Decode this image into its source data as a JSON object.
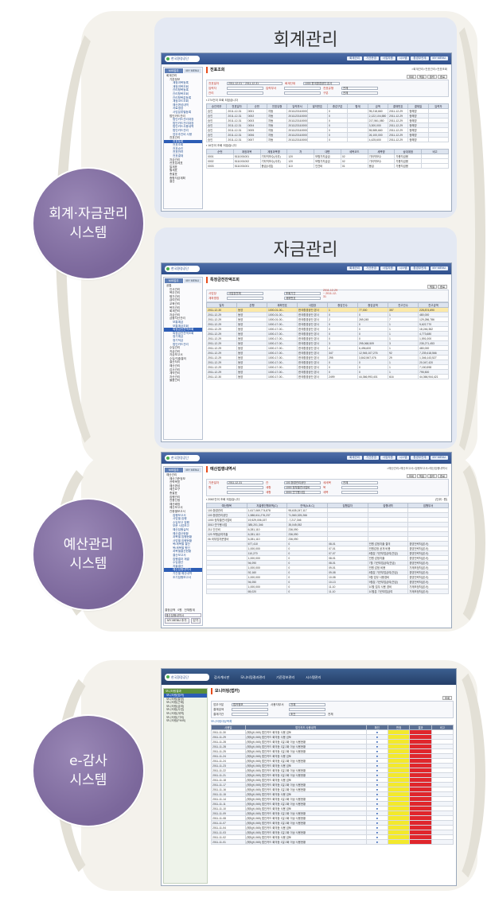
{
  "sections": [
    {
      "id": "accounting",
      "circle_lines": [
        "회계·자금관리",
        "시스템"
      ],
      "cards": [
        {
          "title": "회계관리",
          "screen": {
            "logo": "한국환경공단",
            "menu": [
              "회계관리",
              "기관운영",
              "사업지원",
              "시스템",
              "환경부연계",
              "MY MENU"
            ],
            "side_tabs": [
              "MIS업무",
              "MY MENU"
            ],
            "tree": [
              "회계관리",
              "기본정보",
              "계정과목등록",
              "계정과목조회",
              "관리항목등록",
              "관리항목조회",
              "관리항목값등록",
              "계정코드조회",
              "예산편성내역",
              "자료생성",
              "사업분류별등록",
              "법인카드관리",
              "법인카드관리대장",
              "법인카드관리대장",
              "법인카드사용내역",
              "법인카드관리",
              "업무추진비 사용",
              "전표관리",
              "전표등록",
              "전표조회",
              "전표승인",
              "전표반려",
              "전표결재",
              "자금관리",
              "전표집계표",
              "일계표",
              "월계표",
              "총괄표",
              "종합자금계획",
              "결산"
            ],
            "title": "전표조회",
            "crumb": ">회계관리>전표관리>전표조회",
            "buttons": [
              "조회",
              "엑셀",
              "출력",
              "종료"
            ],
            "form": [
              [
                "전표일자",
                "2011-12-01 ~ 2011-12-31",
                "회계단위",
                "1000 한국환경공단 본사"
              ],
              [
                "입력자",
                "",
                "입력부서",
                "",
                "전표유형",
                "전체"
              ],
              [
                "관리",
                "",
                "",
                "",
                "구분",
                "전체"
              ]
            ],
            "count": "▪ 274건이 조회 되었습니다",
            "headers": [
              "승인여부",
              "전표일자",
              "순번",
              "전표유형",
              "입력부서",
              "발의번호",
              "증감구분",
              "합계",
              "금액",
              "결재번호",
              "결재일",
              "입력자"
            ],
            "rows": [
              [
                "승인",
                "2011-12-31",
                "0001",
                "자동",
                "2011123110000006",
                "",
                "0",
                "",
                "95,218,660",
                "2011-12-29",
                "정혜영"
              ],
              [
                "승인",
                "2011-12-31",
                "0002",
                "자동",
                "2011123110000007",
                "",
                "0",
                "",
                "2,122,104,580",
                "2011-12-29",
                "정혜영"
              ],
              [
                "승인",
                "2011-12-31",
                "0003",
                "자동",
                "2011123110000008",
                "",
                "0",
                "",
                "217,561,080",
                "2011-12-29",
                "정혜영"
              ],
              [
                "승인",
                "2011-12-31",
                "0004",
                "자동",
                "2011123110000009",
                "",
                "0",
                "",
                "3,300,000",
                "2011-12-29",
                "정혜영"
              ],
              [
                "승인",
                "2011-12-31",
                "0005",
                "자동",
                "2011123110000010",
                "",
                "0",
                "",
                "55,585,660",
                "2011-12-29",
                "정혜영"
              ],
              [
                "승인",
                "2011-12-31",
                "0006",
                "자동",
                "2011123110000011",
                "",
                "0",
                "",
                "26,100,000",
                "2011-12-29",
                "정혜영"
              ],
              [
                "승인",
                "2011-12-31",
                "0007",
                "자동",
                "2011123110000012",
                "",
                "0",
                "",
                "4,425,600",
                "2011-12-29",
                "정혜영"
              ]
            ],
            "count2": "▪ 16건이 조회 되었습니다",
            "headers2": [
              "순번",
              "계정과목",
              "계정과목명",
              "차",
              "대변",
              "세목코드",
              "세목명",
              "상대계정",
              "비고"
            ],
            "rows2": [
              [
                "0001",
                "5111001001",
                "기타직보수(사무)",
                "120",
                "보험가지급금",
                "02",
                "기타직보수",
                "가용자금용"
              ],
              [
                "0002",
                "5111001002",
                "기타직보수(사무)",
                "120",
                "보험가지급금",
                "02",
                "기타직보수",
                "가용자금용"
              ],
              [
                "0003",
                "5111001001",
                "봉급(사업)",
                "110",
                "인건비",
                "01",
                "봉급",
                "가용자금용"
              ]
            ]
          }
        },
        {
          "title": "자금관리",
          "screen": {
            "logo": "한국환경공단",
            "menu": [
              "회계관리",
              "기관운영",
              "사업지원",
              "시스템",
              "환경부연계",
              "MY MENU"
            ],
            "side_tabs": [
              "MIS업무",
              "MY MENU"
            ],
            "tree": [
              "공통",
              "인사관리",
              "복무관리",
              "평가관리",
              "급여관리",
              "교육관리",
              "복지관리",
              "회계관리",
              "자금관리",
              "금융자산관리",
              "보통예금",
              "보통예금조회",
              "특정금전잔액조회",
              "특정금전잔액조회",
              "정기예금",
              "정기적금",
              "법인카드관리",
              "수입관리",
              "지급관리",
              "자금보고서",
              "수입/지출결의",
              "결산처리",
              "예산관리",
              "감사관리",
              "계약관리",
              "자산관리",
              "물품관리"
            ],
            "title": "특정금전잔액조회",
            "crumb": "",
            "buttons": [
              "엑셀",
              "종료"
            ],
            "form": [
              [
                "사업장",
                "사업장전체",
                "",
                "조회기간",
                "2011-12-29 ~ 2011-12-31"
              ],
              [
                "계좌명칭",
                "",
                "",
                "계좌번호",
                ""
              ]
            ],
            "headers": [
              "일자",
              "은행",
              "계좌번호",
              "사업장",
              "증감건수",
              "증감금액",
              "잔고건수",
              "잔고금액"
            ],
            "rows": [
              [
                "2011-12-30",
                "동양",
                "1000-01-00...",
                "한국환경공단 본사",
                "1",
                "77,000",
                "357",
                "228,874,690"
              ],
              [
                "2011-12-29",
                "동양",
                "1000-01-00...",
                "한국환경공단 본사",
                "0",
                "0",
                "1",
                "480,000"
              ],
              [
                "2011-12-29",
                "동양",
                "1000-01-00...",
                "한국환경공단 본사",
                "2",
                "269,245",
                "7",
                "129,286,786"
              ],
              [
                "2011-12-29",
                "동양",
                "1000-17-00...",
                "한국환경공단 본사",
                "0",
                "0",
                "1",
                "5,622,770"
              ],
              [
                "2011-12-29",
                "동양",
                "1000-17-00...",
                "한국환경공단 본사",
                "0",
                "0",
                "1",
                "18,246,382"
              ],
              [
                "2011-12-29",
                "동양",
                "1000-17-00...",
                "한국환경공단 본사",
                "0",
                "0",
                "1",
                "4,773,680"
              ],
              [
                "2011-12-29",
                "동양",
                "1000-17-00...",
                "한국환경공단 본사",
                "0",
                "0",
                "1",
                "1,591,000"
              ],
              [
                "2011-12-29",
                "동양",
                "1000-17-00...",
                "한국환경공단 본사",
                "3",
                "295,068,509",
                "3",
                "235,271,453"
              ],
              [
                "2011-12-29",
                "동양",
                "1000-17-00...",
                "한국환경공단 본사",
                "4",
                "6,496,600",
                "1",
                "480,000"
              ],
              [
                "2011-12-29",
                "동양",
                "1000-17-00...",
                "한국환경공단 본사",
                "347",
                "12,945,107,276",
                "92",
                "7,239,418,566"
              ],
              [
                "2011-12-29",
                "동양",
                "1000-17-00...",
                "한국환경공단 본사",
                "295",
                "3,842,567,076",
                "29",
                "1,346,143,527"
              ],
              [
                "2011-12-29",
                "동양",
                "1000-17-00...",
                "한국환경공단 본사",
                "0",
                "0",
                "1",
                "20,047,420"
              ],
              [
                "2011-12-29",
                "동양",
                "1000-17-00...",
                "한국환경공단 본사",
                "0",
                "0",
                "1",
                "7,150,598"
              ],
              [
                "2011-12-29",
                "동양",
                "1000-17-00...",
                "한국환경공단 본사",
                "0",
                "0",
                "1",
                "795,500"
              ],
              [
                "2011-12-30",
                "동양",
                "1000-17-00...",
                "한국환경공단 본사",
                "2499",
                "44,366,993,401",
                "616",
                "44,366,944,421"
              ]
            ]
          }
        }
      ]
    },
    {
      "id": "budget",
      "circle_lines": [
        "예산관리",
        "시스템"
      ],
      "screen": {
        "logo": "한국환경공단",
        "menu": [
          "회계관리",
          "기관운영",
          "사업지원",
          "시스템",
          "환경부연계",
          "MY MENU"
        ],
        "side_tabs": [
          "MIS업무",
          "MY MENU"
        ],
        "tree": [
          "예산관리",
          "예산기준정보",
          "전략목표",
          "예산편성",
          "예산요구",
          "총괄표",
          "집행관리",
          "전용신청",
          "예산배정",
          "예산보고서",
          "관종별보고서",
          "집행보고서",
          "사업별 집행",
          "수입보고 집행",
          "부문 사업보고",
          "예산집행실적",
          "예산결산현황",
          "과목별 집행현황",
          "사업별 집행현황",
          "목/세목별 결산",
          "목/세목별 원인",
          "과목별결산현황",
          "결산보고서",
          "집행결과 재결",
          "수입결산",
          "지출결산",
          "예산집행내역서",
          "기간별 예산내역",
          "조기집행보고서"
        ],
        "side_bottom": [
          "결정금액",
          "0원",
          "전체합계"
        ],
        "side_select": "예산집행내역서",
        "side_btns": [
          "MY MENU 추가",
          "닫기"
        ],
        "title": "예산집행내역서",
        "crumb": ">예산관리>예산보고서>집행보고서>예산집행내역서",
        "buttons": [
          "조회",
          "엑셀",
          "출력",
          "종료"
        ],
        "form": [
          [
            "기준일자",
            "2011-12-31",
            "관",
            "100 환경관리공단",
            "세세목",
            "전체"
          ],
          [
            "항",
            "",
            "세항",
            "1000 정부출연사업비",
            "목",
            ""
          ],
          [
            "",
            "",
            "세항",
            "3000 연구용사업",
            "세목",
            ""
          ]
        ],
        "count": "▪ 2082건이 조회 되었습니다",
        "unit": "(단위 : 원)",
        "headers": [
          "예산항목",
          "지출원인행위액(C)",
          "잔액(A-B-C)",
          "집행일자",
          "집행내역",
          "집행부서"
        ],
        "rows": [
          [
            "100 환경관리",
            "1,617,069,774,878",
            "95,635,247,117",
            "",
            "",
            ""
          ],
          [
            "100 환경관리공단",
            "1,588,611,276,237",
            "71,560,325,266",
            "",
            "",
            ""
          ],
          [
            "1000 정부출연사업비",
            "19,529,006,157",
            "-7,217,346",
            "",
            "",
            ""
          ],
          [
            "3010 연구용사업",
            "385,201,346",
            "35,045,052",
            "",
            "",
            ""
          ],
          [
            "211 인건비",
            "6,281,110",
            "236,090",
            "",
            "",
            ""
          ],
          [
            "120 보험급여지출",
            "6,281,110",
            "236,090",
            "",
            "",
            ""
          ],
          [
            "06 외부업자운영비",
            "6,281,110",
            "236,090",
            "",
            "",
            ""
          ],
          [
            "",
            "677,410",
            "0",
            "08-01",
            "민원 감정지출 결의",
            "경영전략처(본사)"
          ],
          [
            "",
            "1,000,000",
            "0",
            "07-01",
            "민원감정 공개 비용",
            "경영전략처(본사)"
          ],
          [
            "",
            "110,270",
            "0",
            "07-07",
            "8월분 기관부업급여(연금)",
            "경영전략처(본사)"
          ],
          [
            "",
            "1,000,000",
            "0",
            "08-01",
            "민원 감정지출",
            "경영전략처(본사)"
          ],
          [
            "",
            "94,090",
            "0",
            "08-01",
            "7월 기관부업급여(연금)",
            "경영전략처(본사)"
          ],
          [
            "",
            "1,000,000",
            "0",
            "09-01",
            "민원 감정 비용",
            "가재조정처(본사)"
          ],
          [
            "",
            "92,160",
            "0",
            "09-08",
            "8월분 기관부업급여(연금)",
            "경영전략처(본사)"
          ],
          [
            "",
            "1,000,000",
            "0",
            "10-08",
            "9월 업무 사용경비",
            "경영전략처(본사)"
          ],
          [
            "",
            "94,050",
            "0",
            "10-13",
            "9월분 기관부업급여(연금)",
            "경영전략처(본사)"
          ],
          [
            "",
            "1,000,000",
            "0",
            "11-10",
            "10월 업무 사용 경비",
            "가재조정처(본사)"
          ],
          [
            "",
            "65,020",
            "0",
            "11-10",
            "10월분 기관부업급여",
            "가재조정처(본사)"
          ]
        ]
      }
    },
    {
      "id": "audit",
      "circle_lines": [
        "e-감사",
        "시스템"
      ],
      "screen": {
        "logo": "한국환경공단",
        "nav": [
          "감사계시판",
          "모니터링결과관리",
          "기준정보관리",
          "시스템관리"
        ],
        "side_header": "모니터링결과",
        "tree": [
          "모니터링(법카)",
          "모니터링(출장)",
          "모니터링(근태)",
          "모니터링(급여)",
          "모니터링(사업)",
          "모니터링(계약)",
          "모니터링(기타)",
          "모니터링(FMIS)"
        ],
        "title": "모니터링(법카)",
        "buttons": [
          "조회"
        ],
        "form": [
          [
            "업무구분",
            "법카정보",
            "사용자부서",
            "전체"
          ],
          [
            "결재검색",
            "",
            "",
            ""
          ],
          [
            "결재기간",
            "",
            "",
            " 조건",
            "전체"
          ]
        ],
        "list_title": "모니터링대상목록",
        "headers": [
          "사용일",
          "법인카드 사용내역",
          "확인",
          "판정",
          "결과",
          "비고"
        ],
        "rows": [
          [
            "2011-11-30",
            "(제5)(K,065) 법인카드 회의등 사용 검토"
          ],
          [
            "2011-11-29",
            "(제5)(K,065) 법인카드 회의등 사용 검토"
          ],
          [
            "2011-11-28",
            "(제5)(K,065) 법인카드 회의등 1일 2회 이상 사용현황"
          ],
          [
            "2011-11-28",
            "(제5)(K,065) 법인카드 회의등 1일 2회 이상 사용현황"
          ],
          [
            "2011-11-25",
            "(제5)(K,065) 법인카드 회의등 1일 2회 이상 사용현황"
          ],
          [
            "2011-11-24",
            "(제5)(K,065) 법인카드 회의등 사용 검토"
          ],
          [
            "2011-11-24",
            "(제5)(K,065) 법인카드 회의등 1일 2회 이상 사용현황"
          ],
          [
            "2011-11-23",
            "(제5)(K,065) 법인카드 회의등 사용 검토"
          ],
          [
            "2011-11-22",
            "(제5)(K,065) 법인카드 회의등 1일 2회 이상 사용현황"
          ],
          [
            "2011-11-21",
            "(제5)(K,065) 법인카드 회의등 1일 2회 이상 사용현황"
          ],
          [
            "2011-11-18",
            "(제5)(K,065) 법인카드 회의등 사용 검토"
          ],
          [
            "2011-11-17",
            "(제5)(K,065) 법인카드 회의등 1일 2회 이상 사용현황"
          ],
          [
            "2011-11-16",
            "(제5)(K,065) 법인카드 회의등 1일 2회 이상 사용현황"
          ],
          [
            "2011-11-15",
            "(제5)(K,065) 법인카드 회의등 사용 검토"
          ],
          [
            "2011-11-14",
            "(제5)(K,065) 법인카드 회의등 1일 2회 이상 사용현황"
          ],
          [
            "2011-11-11",
            "(제5)(K,065) 법인카드 회의등 1일 2회 이상 사용현황"
          ],
          [
            "2011-11-10",
            "(제5)(K,065) 법인카드 회의등 사용 검토"
          ],
          [
            "2011-11-09",
            "(제5)(K,065) 법인카드 회의등 1일 2회 이상 사용현황"
          ],
          [
            "2011-11-08",
            "(제5)(K,065) 법인카드 회의등 1일 2회 이상 사용현황"
          ],
          [
            "2011-11-07",
            "(제5)(K,065) 법인카드 회의등 1일 2회 이상 사용현황"
          ],
          [
            "2011-11-04",
            "(제5)(K,065) 법인카드 회의등 사용 검토"
          ],
          [
            "2011-11-03",
            "(제5)(K,065) 법인카드 회의등 1일 2회 이상 사용현황"
          ],
          [
            "2011-11-02",
            "(제5)(K,065) 법인카드 회의등 사용 검토"
          ],
          [
            "2011-11-01",
            "(제5)(K,065) 법인카드 회의등 1일 2회 이상 사용현황"
          ]
        ]
      }
    }
  ],
  "colors": {
    "circle": "#7b679b",
    "card_bg": "#e4e9f3",
    "arc": "#e3e0d6",
    "header_blue": "#2e4f8c",
    "warn_yellow": "#f3e92c",
    "warn_red": "#e0262c"
  }
}
